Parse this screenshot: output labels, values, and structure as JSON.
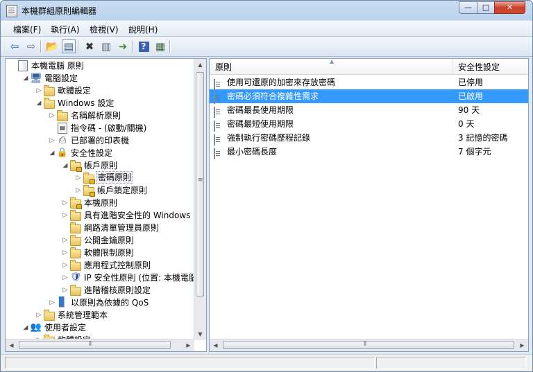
{
  "window": {
    "title": "本機群組原則編輯器",
    "minimize": "—",
    "maximize": "□",
    "close": "✕"
  },
  "menu": [
    "檔案(F)",
    "執行(A)",
    "檢視(V)",
    "說明(H)"
  ],
  "toolbar": {
    "buttons": [
      {
        "name": "back-icon",
        "glyph": "⇦",
        "color": "#2a6bc1"
      },
      {
        "name": "forward-icon",
        "glyph": "⇨",
        "color": "#6a7d93"
      },
      {
        "name": "up-folder-icon",
        "glyph": "📂",
        "color": "#c69a2a"
      },
      {
        "name": "show-hide-tree-icon",
        "glyph": "▤",
        "color": "#3c5f88",
        "pressed": true
      },
      {
        "name": "delete-icon",
        "glyph": "✖",
        "color": "#333333"
      },
      {
        "name": "properties-icon",
        "glyph": "▥",
        "color": "#5f6c7a"
      },
      {
        "name": "export-list-icon",
        "glyph": "➜",
        "color": "#4a8a2a"
      },
      {
        "name": "help-icon",
        "glyph": "?",
        "color": "#ffffff"
      },
      {
        "name": "show-action-pane-icon",
        "glyph": "▦",
        "color": "#3d6a3a"
      }
    ]
  },
  "tree": [
    {
      "label": "本機電腦 原則",
      "indent": 0,
      "icon": "policy",
      "toggle": ""
    },
    {
      "label": "電腦設定",
      "indent": 1,
      "icon": "computer",
      "toggle": "◢"
    },
    {
      "label": "軟體設定",
      "indent": 2,
      "icon": "folder",
      "toggle": "▷"
    },
    {
      "label": "Windows 設定",
      "indent": 2,
      "icon": "folder",
      "toggle": "◢"
    },
    {
      "label": "名稱解析原則",
      "indent": 3,
      "icon": "folder",
      "toggle": "▷"
    },
    {
      "label": "指令碼 - (啟動/關機)",
      "indent": 3,
      "icon": "script",
      "toggle": ""
    },
    {
      "label": "已部署的印表機",
      "indent": 3,
      "icon": "printer",
      "toggle": "▷"
    },
    {
      "label": "安全性設定",
      "indent": 3,
      "icon": "security",
      "toggle": "◢"
    },
    {
      "label": "帳戶原則",
      "indent": 4,
      "icon": "lockfolder",
      "toggle": "◢"
    },
    {
      "label": "密碼原則",
      "indent": 5,
      "icon": "lockfolder",
      "toggle": "▷",
      "selected": true
    },
    {
      "label": "帳戶鎖定原則",
      "indent": 5,
      "icon": "lockfolder",
      "toggle": "▷"
    },
    {
      "label": "本機原則",
      "indent": 4,
      "icon": "lockfolder",
      "toggle": "▷"
    },
    {
      "label": "具有進階安全性的 Windows 防火",
      "indent": 4,
      "icon": "folder",
      "toggle": "▷"
    },
    {
      "label": "網路清單管理員原則",
      "indent": 4,
      "icon": "folder",
      "toggle": ""
    },
    {
      "label": "公開金鑰原則",
      "indent": 4,
      "icon": "folder",
      "toggle": "▷"
    },
    {
      "label": "軟體限制原則",
      "indent": 4,
      "icon": "folder",
      "toggle": "▷"
    },
    {
      "label": "應用程式控制原則",
      "indent": 4,
      "icon": "folder",
      "toggle": "▷"
    },
    {
      "label": "IP 安全性原則 (位置: 本機電腦)",
      "indent": 4,
      "icon": "ipsec",
      "toggle": "▷"
    },
    {
      "label": "進階稽核原則設定",
      "indent": 4,
      "icon": "folder",
      "toggle": "▷"
    },
    {
      "label": "以原則為依據的 QoS",
      "indent": 3,
      "icon": "qos",
      "toggle": "▷"
    },
    {
      "label": "系統管理範本",
      "indent": 2,
      "icon": "folder",
      "toggle": "▷"
    },
    {
      "label": "使用者設定",
      "indent": 1,
      "icon": "user",
      "toggle": "◢"
    },
    {
      "label": "軟體設定",
      "indent": 2,
      "icon": "folder",
      "toggle": "▷"
    }
  ],
  "list": {
    "columns": [
      "原則",
      "安全性設定"
    ],
    "rows": [
      {
        "name": "使用可還原的加密來存放密碼",
        "value": "已停用"
      },
      {
        "name": "密碼必須符合複雜性需求",
        "value": "已啟用",
        "selected": true
      },
      {
        "name": "密碼最長使用期限",
        "value": "90 天"
      },
      {
        "name": "密碼最短使用期限",
        "value": "0 天"
      },
      {
        "name": "強制執行密碼歷程記錄",
        "value": "3 記憶的密碼"
      },
      {
        "name": "最小密碼長度",
        "value": "7 個字元"
      }
    ]
  },
  "scrollbar": {
    "up": "▲",
    "down": "▼",
    "left": "◀",
    "right": "▶",
    "grip_v": "≡",
    "grip_h": "⦀"
  }
}
